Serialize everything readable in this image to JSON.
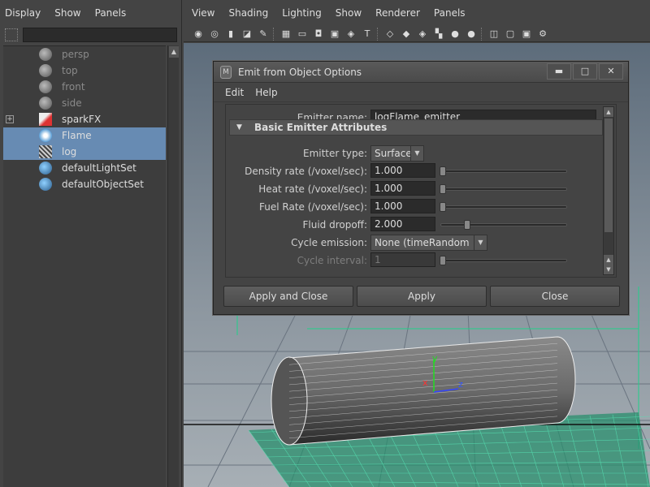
{
  "outliner": {
    "menu": [
      "Display",
      "Show",
      "Panels"
    ],
    "items": [
      {
        "label": "persp",
        "icon": "camera-icon",
        "dim": true,
        "selected": false,
        "expandable": false
      },
      {
        "label": "top",
        "icon": "camera-icon",
        "dim": true,
        "selected": false,
        "expandable": false
      },
      {
        "label": "front",
        "icon": "camera-icon",
        "dim": true,
        "selected": false,
        "expandable": false
      },
      {
        "label": "side",
        "icon": "camera-icon",
        "dim": true,
        "selected": false,
        "expandable": false
      },
      {
        "label": "sparkFX",
        "icon": "particle-icon",
        "dim": false,
        "selected": false,
        "expandable": true
      },
      {
        "label": "Flame",
        "icon": "fluid-icon",
        "dim": false,
        "selected": true,
        "expandable": false
      },
      {
        "label": "log",
        "icon": "mesh-icon",
        "dim": false,
        "selected": true,
        "expandable": false
      },
      {
        "label": "defaultLightSet",
        "icon": "set-icon",
        "dim": false,
        "selected": false,
        "expandable": false
      },
      {
        "label": "defaultObjectSet",
        "icon": "set-icon",
        "dim": false,
        "selected": false,
        "expandable": false
      }
    ]
  },
  "viewport": {
    "menu": [
      "View",
      "Shading",
      "Lighting",
      "Show",
      "Renderer",
      "Panels"
    ],
    "axis_labels": {
      "y": "y",
      "x": "x",
      "z": "z"
    }
  },
  "dialog": {
    "title": "Emit from Object Options",
    "window_buttons": {
      "minimize": "▬",
      "maximize": "□",
      "close": "✕"
    },
    "menu": [
      "Edit",
      "Help"
    ],
    "emitter_name_label": "Emitter name:",
    "emitter_name_value": "logFlame_emitter",
    "section_title": "Basic Emitter Attributes",
    "fields": [
      {
        "label": "Emitter type:",
        "kind": "dropdown",
        "value": "Surface"
      },
      {
        "label": "Density rate (/voxel/sec):",
        "kind": "slider",
        "value": "1.000",
        "level": 0.0
      },
      {
        "label": "Heat rate (/voxel/sec):",
        "kind": "slider",
        "value": "1.000",
        "level": 0.0
      },
      {
        "label": "Fuel Rate (/voxel/sec):",
        "kind": "slider",
        "value": "1.000",
        "level": 0.0
      },
      {
        "label": "Fluid dropoff:",
        "kind": "slider",
        "value": "2.000",
        "level": 0.2
      },
      {
        "label": "Cycle emission:",
        "kind": "dropdown",
        "value": "None (timeRandom off)"
      },
      {
        "label": "Cycle interval:",
        "kind": "slider",
        "value": "1",
        "level": 0.0,
        "disabled": true
      }
    ],
    "buttons": {
      "apply_close": "Apply and Close",
      "apply": "Apply",
      "close": "Close"
    }
  }
}
